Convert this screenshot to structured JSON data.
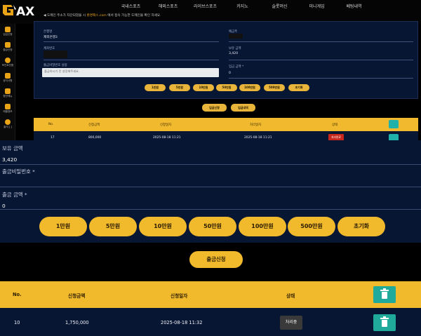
{
  "brand": {
    "logo_text": "AX",
    "accent": "#f1b92c"
  },
  "nav": [
    "국내스포츠",
    "해외스포츠",
    "라이브스포츠",
    "카지노",
    "슬롯머신",
    "미니게임",
    "베팅내역"
  ],
  "notice": {
    "prefix": "◀ 도메인 주소가 차단되었을 시",
    "highlight": "환경팩스.com",
    "suffix": "에서 접속 가능한 도메인을 확인 하세요.",
    "dim_suffix": ""
  },
  "sidebar": [
    {
      "label": "입금신청",
      "icon": "wallet-icon"
    },
    {
      "label": "출금신청",
      "icon": "withdraw-icon"
    },
    {
      "label": "포인트전환",
      "icon": "point-icon"
    },
    {
      "label": "공지사항",
      "icon": "notice-icon"
    },
    {
      "label": "환전메뉴",
      "icon": "exchange-icon"
    },
    {
      "label": "레벨정보",
      "icon": "level-icon"
    },
    {
      "label": "출석 [ ]",
      "icon": "attendance-icon"
    }
  ],
  "top_panel": {
    "name_label": "은행명",
    "name_value": "제외은행3",
    "depositor_label": "예금주",
    "account_label": "계좌번호",
    "balance_label": "보유 금액",
    "balance_value": "3,420",
    "password_label": "출금비밀번호 설정",
    "password_placeholder": "출금하시기 전 설정해주세요.",
    "amount_label": "입금 금액 *",
    "amount_value": "0",
    "mini_buttons": [
      "1만원",
      "5만원",
      "10만원",
      "50만원",
      "100만원",
      "500만원",
      "초기화"
    ],
    "mid_buttons": [
      "입금신청",
      "입금내역"
    ]
  },
  "mini_table": {
    "headers": [
      "No.",
      "신청금액",
      "신청일자",
      "처리일자",
      "상태"
    ],
    "row": {
      "no": "17",
      "amount": "800,000",
      "requested": "2025-08-18 11:21",
      "processed": "2025-08-18 11:21",
      "status": "처리완료"
    }
  },
  "form": {
    "balance_label": "보유 금액",
    "balance_value": "3,420",
    "password_label": "출금비밀번호 *",
    "withdraw_label": "출금 금액 *",
    "withdraw_value": "0",
    "amount_buttons": [
      "1만원",
      "5만원",
      "10만원",
      "50만원",
      "100만원",
      "500만원",
      "초기화"
    ],
    "apply_label": "출금신청"
  },
  "table": {
    "headers": {
      "no": "No.",
      "amount": "신청금액",
      "date": "신청일자",
      "status": "상태"
    },
    "rows": [
      {
        "no": "10",
        "amount": "1,750,000",
        "date": "2025-08-18 11:32",
        "status": "처리중"
      }
    ]
  }
}
